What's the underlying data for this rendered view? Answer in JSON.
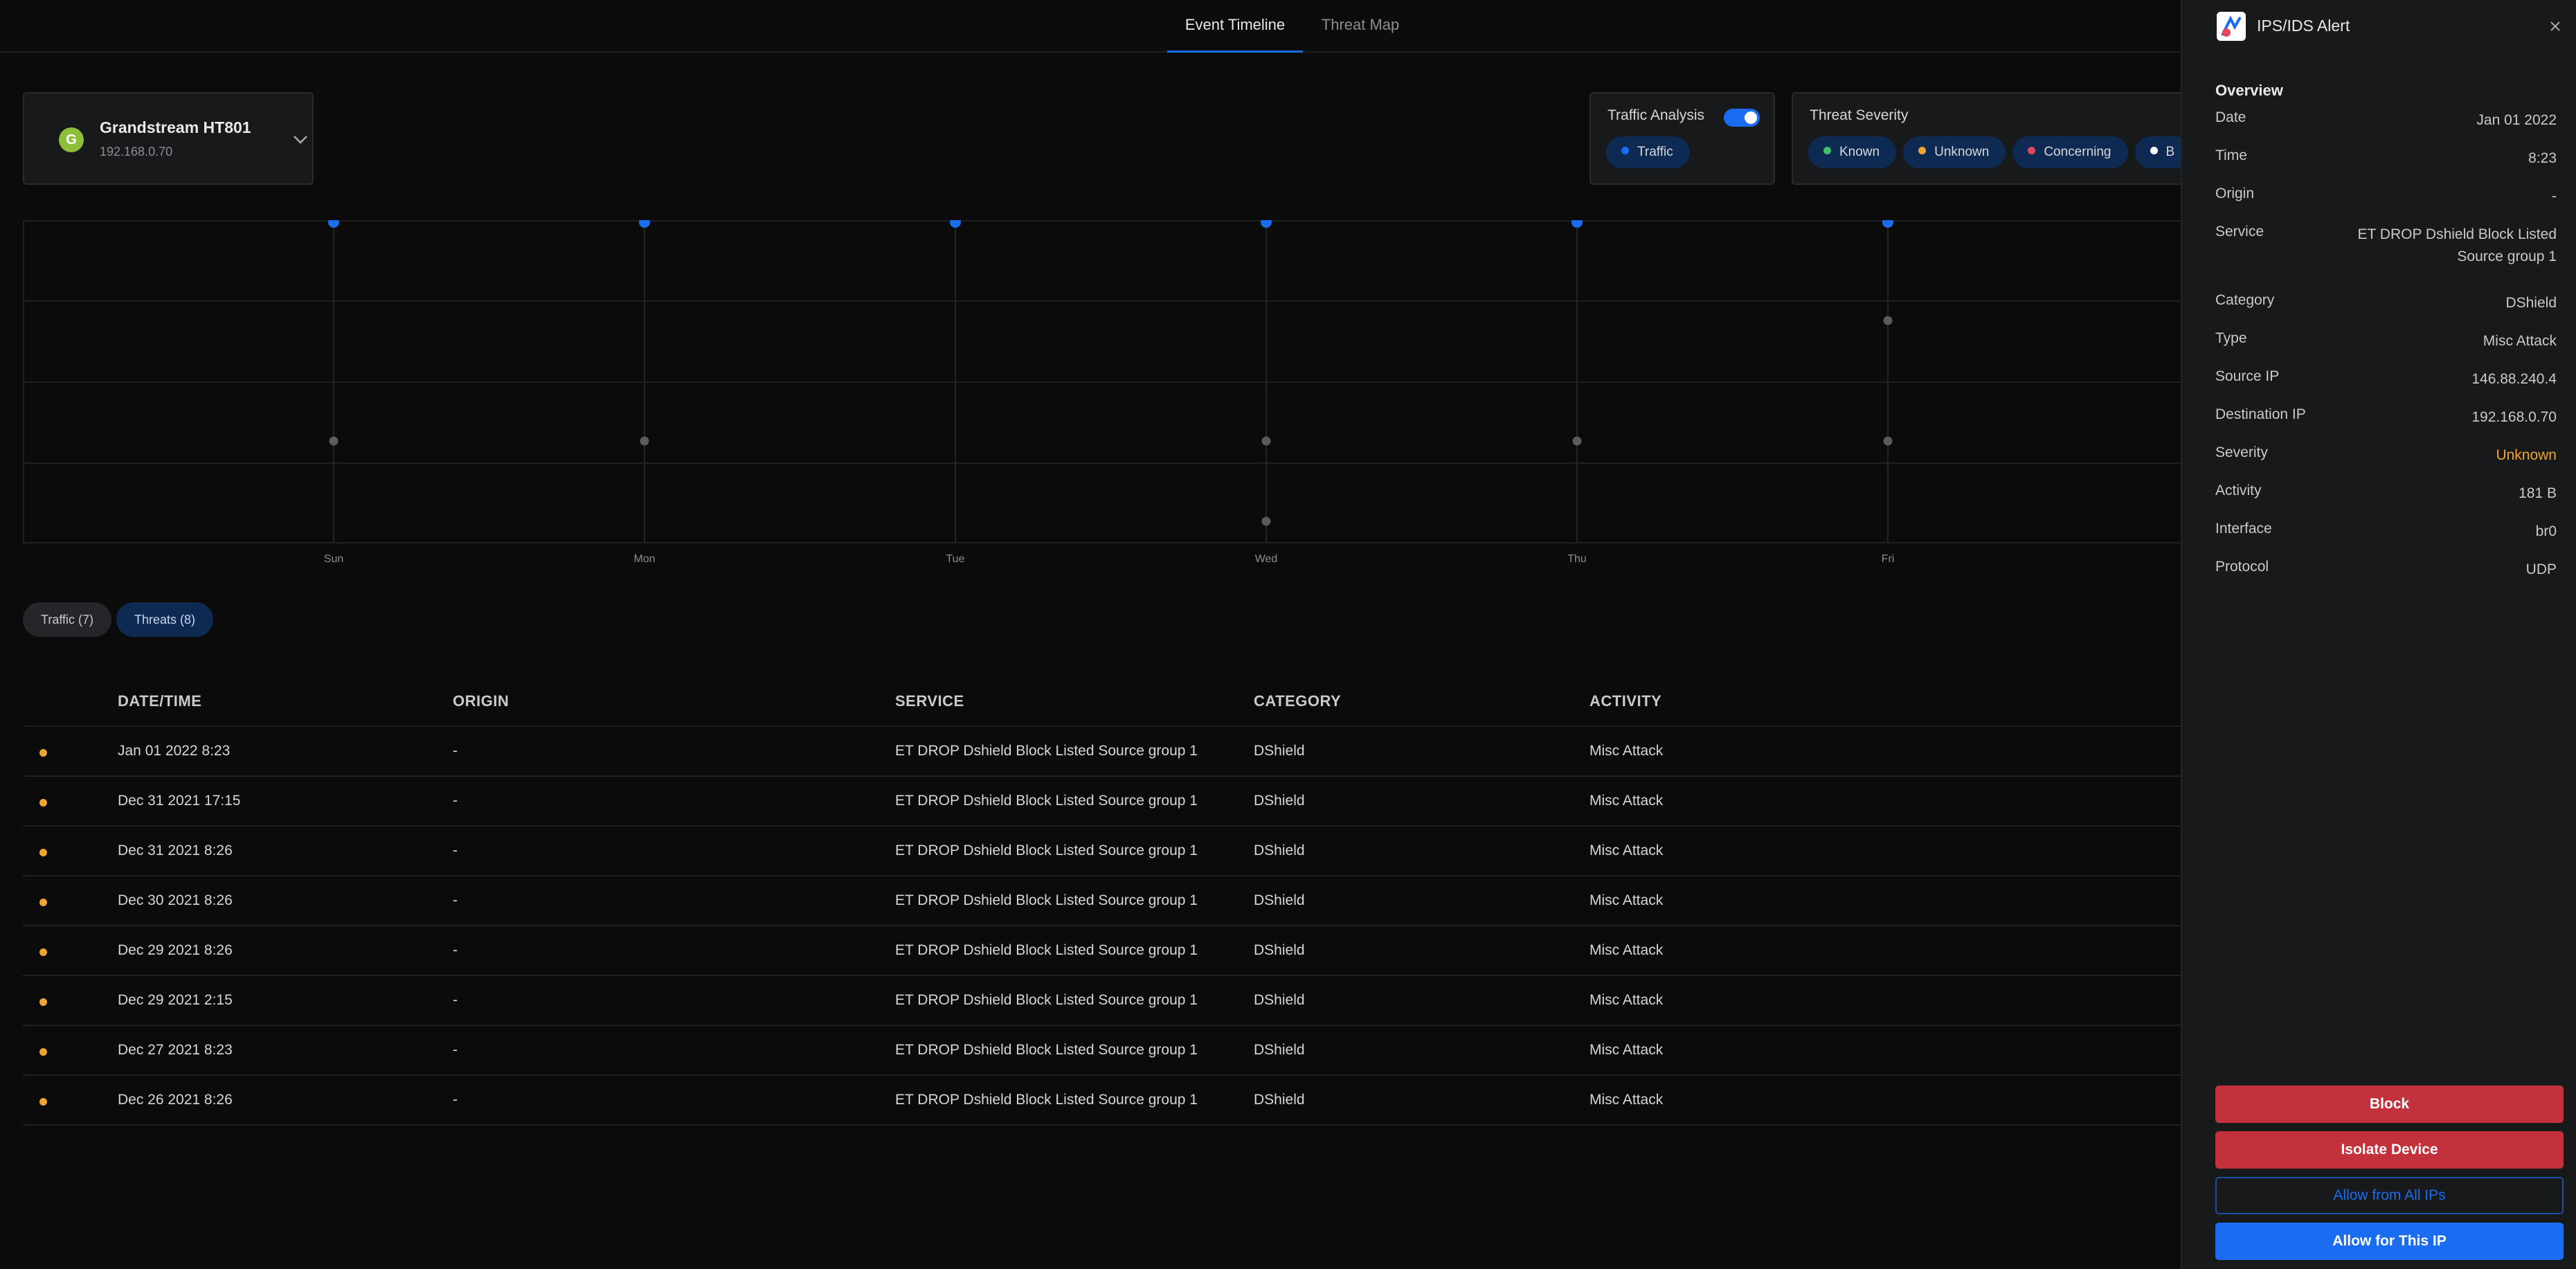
{
  "tabs": [
    {
      "label": "Event Timeline",
      "active": true
    },
    {
      "label": "Threat Map",
      "active": false
    }
  ],
  "device": {
    "initial": "G",
    "name": "Grandstream HT801",
    "ip": "192.168.0.70",
    "avatar_color": "#8fbf3a"
  },
  "traffic_analysis": {
    "title": "Traffic Analysis",
    "toggle_on": true,
    "chips": [
      {
        "label": "Traffic",
        "color": "#1a6cf0"
      }
    ]
  },
  "threat_severity": {
    "title": "Threat Severity",
    "chips": [
      {
        "label": "Known",
        "color": "#3fbf6a"
      },
      {
        "label": "Unknown",
        "color": "#f0a531"
      },
      {
        "label": "Concerning",
        "color": "#e5475a"
      },
      {
        "label": "B",
        "color": "#ffffff"
      }
    ]
  },
  "timeline": {
    "days": [
      "Sun",
      "Mon",
      "Tue",
      "Wed",
      "Thu",
      "Fri"
    ],
    "traffic_events": [
      0,
      1,
      2,
      3,
      4,
      5
    ],
    "threat_events": [
      {
        "day": 0,
        "level": 1
      },
      {
        "day": 1,
        "level": 1
      },
      {
        "day": 3,
        "level": 1
      },
      {
        "day": 3,
        "level": 0
      },
      {
        "day": 4,
        "level": 1
      },
      {
        "day": 5,
        "level": 1
      },
      {
        "day": 5,
        "level": 2.5
      }
    ],
    "colors": {
      "traffic": "#1a6cf0",
      "threat": "#5a5b5e"
    }
  },
  "filters": {
    "traffic": "Traffic (7)",
    "threats": "Threats (8)"
  },
  "table": {
    "columns": [
      "DATE/TIME",
      "ORIGIN",
      "SERVICE",
      "CATEGORY",
      "ACTIVITY"
    ],
    "rows": [
      {
        "date": "Jan 01 2022 8:23",
        "origin": "-",
        "service": "ET DROP Dshield Block Listed Source group 1",
        "category": "DShield",
        "activity": "Misc Attack"
      },
      {
        "date": "Dec 31 2021 17:15",
        "origin": "-",
        "service": "ET DROP Dshield Block Listed Source group 1",
        "category": "DShield",
        "activity": "Misc Attack"
      },
      {
        "date": "Dec 31 2021 8:26",
        "origin": "-",
        "service": "ET DROP Dshield Block Listed Source group 1",
        "category": "DShield",
        "activity": "Misc Attack"
      },
      {
        "date": "Dec 30 2021 8:26",
        "origin": "-",
        "service": "ET DROP Dshield Block Listed Source group 1",
        "category": "DShield",
        "activity": "Misc Attack"
      },
      {
        "date": "Dec 29 2021 8:26",
        "origin": "-",
        "service": "ET DROP Dshield Block Listed Source group 1",
        "category": "DShield",
        "activity": "Misc Attack"
      },
      {
        "date": "Dec 29 2021 2:15",
        "origin": "-",
        "service": "ET DROP Dshield Block Listed Source group 1",
        "category": "DShield",
        "activity": "Misc Attack"
      },
      {
        "date": "Dec 27 2021 8:23",
        "origin": "-",
        "service": "ET DROP Dshield Block Listed Source group 1",
        "category": "DShield",
        "activity": "Misc Attack"
      },
      {
        "date": "Dec 26 2021 8:26",
        "origin": "-",
        "service": "ET DROP Dshield Block Listed Source group 1",
        "category": "DShield",
        "activity": "Misc Attack"
      }
    ]
  },
  "panel": {
    "title": "IPS/IDS Alert",
    "overview_title": "Overview",
    "fields": [
      {
        "key": "Date",
        "value": "Jan 01 2022"
      },
      {
        "key": "Time",
        "value": "8:23"
      },
      {
        "key": "Origin",
        "value": "-"
      },
      {
        "key": "Service",
        "value": "ET DROP Dshield Block Listed Source group 1"
      },
      {
        "key": "Category",
        "value": "DShield"
      },
      {
        "key": "Type",
        "value": "Misc Attack"
      },
      {
        "key": "Source IP",
        "value": "146.88.240.4"
      },
      {
        "key": "Destination IP",
        "value": "192.168.0.70"
      },
      {
        "key": "Severity",
        "value": "Unknown",
        "warn": true
      },
      {
        "key": "Activity",
        "value": "181 B"
      },
      {
        "key": "Interface",
        "value": "br0"
      },
      {
        "key": "Protocol",
        "value": "UDP"
      }
    ],
    "buttons": {
      "block": "Block",
      "isolate": "Isolate Device",
      "allow_all": "Allow from All IPs",
      "allow_ip": "Allow for This IP"
    }
  }
}
